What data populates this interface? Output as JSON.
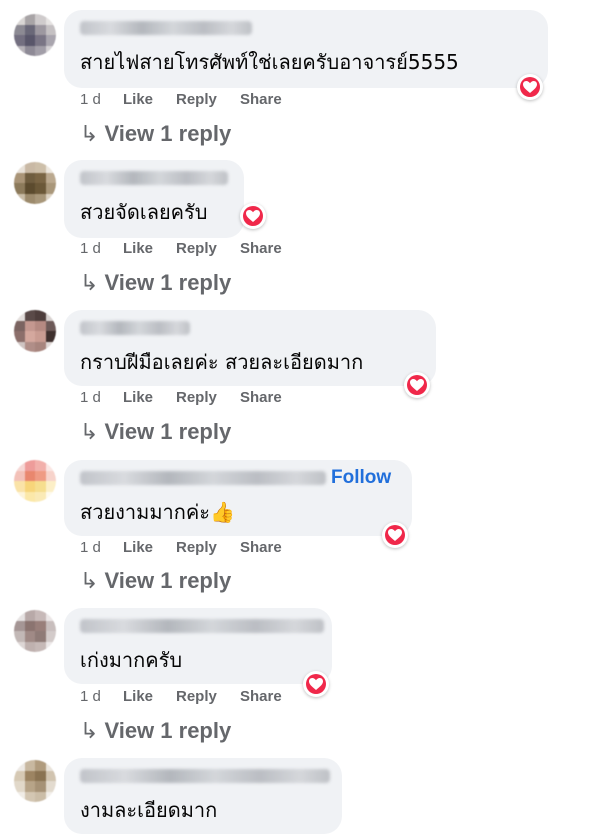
{
  "comments": [
    {
      "text": "สายไฟสายโทรศัพท์ใช่เลยครับอาจารย์5555",
      "has_reaction": true,
      "time": "1 d",
      "like": "Like",
      "reply": "Reply",
      "share": "Share",
      "view_replies": "View 1 reply",
      "follow": null
    },
    {
      "text": "สวยจัดเลยครับ",
      "has_reaction": true,
      "time": "1 d",
      "like": "Like",
      "reply": "Reply",
      "share": "Share",
      "view_replies": "View 1 reply",
      "follow": null
    },
    {
      "text": "กราบฝีมือเลยค่ะ สวยละเอียดมาก",
      "has_reaction": true,
      "time": "1 d",
      "like": "Like",
      "reply": "Reply",
      "share": "Share",
      "view_replies": "View 1 reply",
      "follow": null
    },
    {
      "text": "สวยงามมากค่ะ👍",
      "has_reaction": true,
      "time": "1 d",
      "like": "Like",
      "reply": "Reply",
      "share": "Share",
      "view_replies": "View 1 reply",
      "follow": "Follow"
    },
    {
      "text": "เก่งมากครับ",
      "has_reaction": true,
      "time": "1 d",
      "like": "Like",
      "reply": "Reply",
      "share": "Share",
      "view_replies": "View 1 reply",
      "follow": null
    },
    {
      "text": "งามละเอียดมาก",
      "has_reaction": false,
      "time": null,
      "like": null,
      "reply": null,
      "share": null,
      "view_replies": null,
      "follow": null
    }
  ],
  "icons": {
    "reaction": "heart-icon",
    "reply_arrow": "reply-arrow-icon"
  },
  "colors": {
    "bubble": "#f0f2f5",
    "meta_text": "#65676b",
    "follow": "#216fdb",
    "heart": "#f0284a"
  }
}
